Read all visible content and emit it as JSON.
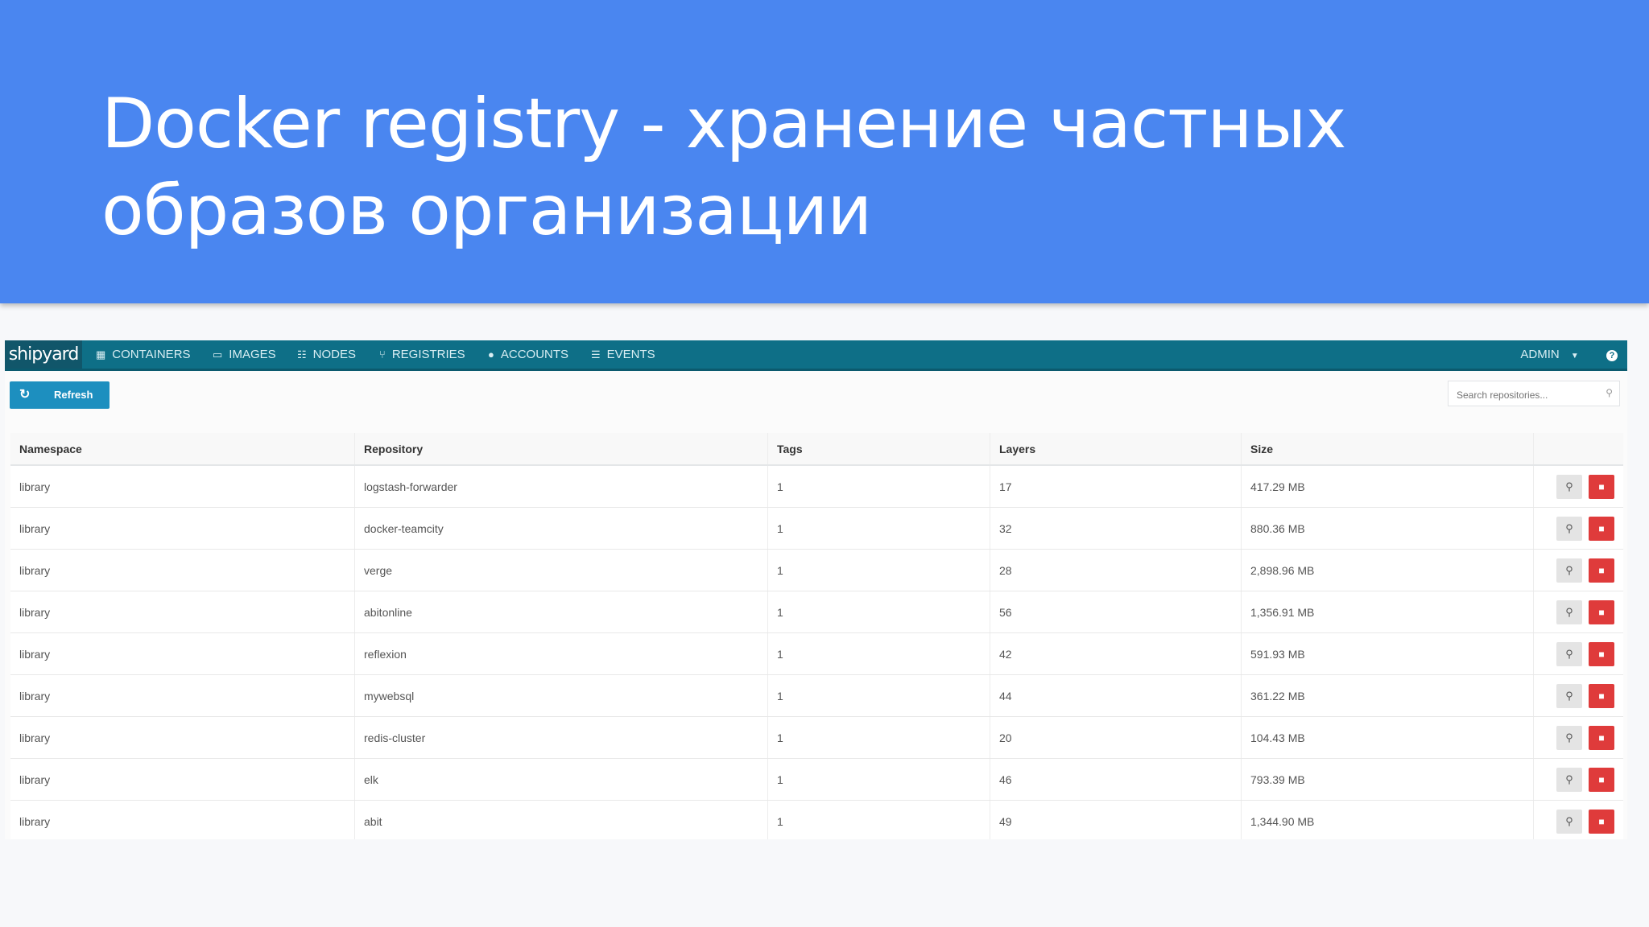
{
  "slide": {
    "title_line1": "Docker registry - хранение частных",
    "title_line2": "образов организации",
    "header_color": "#4a86f0"
  },
  "app": {
    "logo": "shipyard",
    "nav": [
      {
        "label": "CONTAINERS",
        "icon": "grid-icon"
      },
      {
        "label": "IMAGES",
        "icon": "image-icon"
      },
      {
        "label": "NODES",
        "icon": "sitemap-icon"
      },
      {
        "label": "REGISTRIES",
        "icon": "fork-icon"
      },
      {
        "label": "ACCOUNTS",
        "icon": "user-icon"
      },
      {
        "label": "EVENTS",
        "icon": "list-icon"
      }
    ],
    "user": "ADMIN",
    "navbar_color": "#0e6f87",
    "toolbar": {
      "refresh_label": "Refresh",
      "search_placeholder": "Search repositories..."
    },
    "table": {
      "columns": [
        "Namespace",
        "Repository",
        "Tags",
        "Layers",
        "Size"
      ],
      "rows": [
        {
          "namespace": "library",
          "repository": "logstash-forwarder",
          "tags": "1",
          "layers": "17",
          "size": "417.29 MB"
        },
        {
          "namespace": "library",
          "repository": "docker-teamcity",
          "tags": "1",
          "layers": "32",
          "size": "880.36 MB"
        },
        {
          "namespace": "library",
          "repository": "verge",
          "tags": "1",
          "layers": "28",
          "size": "2,898.96 MB"
        },
        {
          "namespace": "library",
          "repository": "abitonline",
          "tags": "1",
          "layers": "56",
          "size": "1,356.91 MB"
        },
        {
          "namespace": "library",
          "repository": "reflexion",
          "tags": "1",
          "layers": "42",
          "size": "591.93 MB"
        },
        {
          "namespace": "library",
          "repository": "mywebsql",
          "tags": "1",
          "layers": "44",
          "size": "361.22 MB"
        },
        {
          "namespace": "library",
          "repository": "redis-cluster",
          "tags": "1",
          "layers": "20",
          "size": "104.43 MB"
        },
        {
          "namespace": "library",
          "repository": "elk",
          "tags": "1",
          "layers": "46",
          "size": "793.39 MB"
        },
        {
          "namespace": "library",
          "repository": "abit",
          "tags": "1",
          "layers": "49",
          "size": "1,344.90 MB"
        }
      ]
    }
  }
}
